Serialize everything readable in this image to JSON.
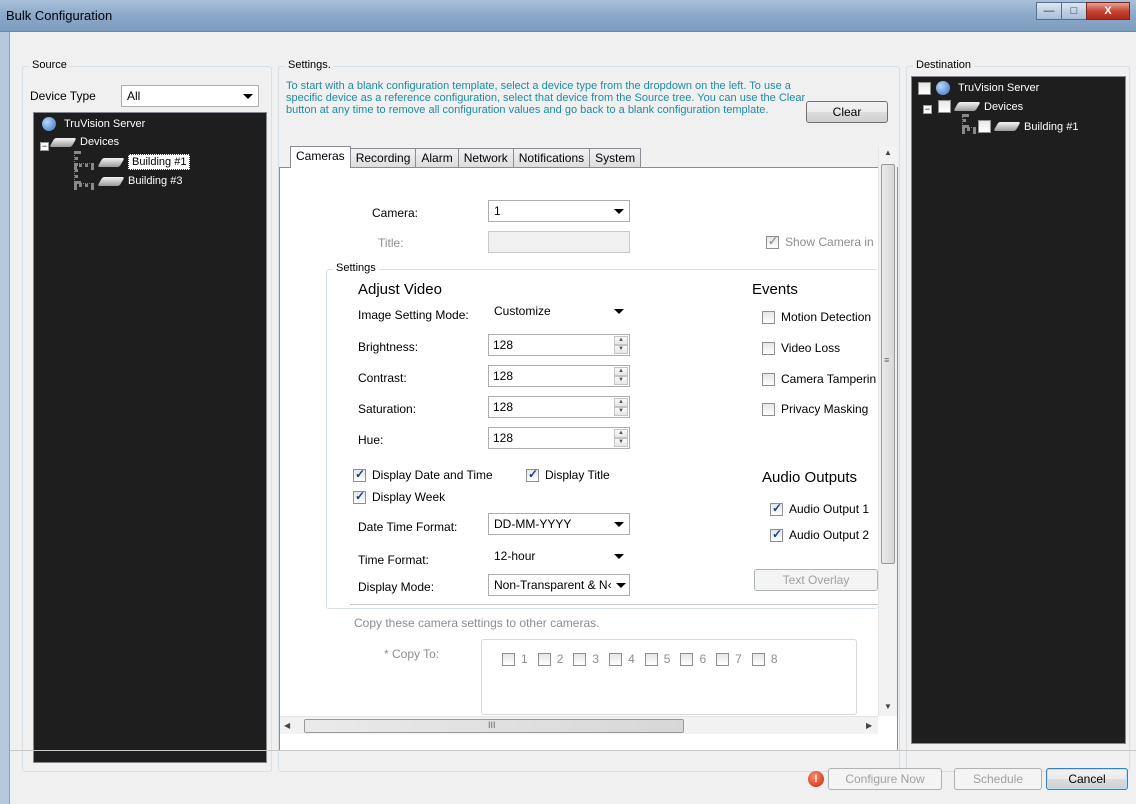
{
  "window": {
    "title": "Bulk Configuration",
    "minimize": "—",
    "maximize": "□",
    "close": "X"
  },
  "source": {
    "legend": "Source",
    "device_type_label": "Device Type",
    "device_type_value": "All",
    "tree": {
      "root": "TruVision Server",
      "devices": "Devices",
      "items": [
        "Building #1",
        "Building #3"
      ]
    }
  },
  "settings": {
    "legend": "Settings.",
    "instructions": "To start with a blank configuration template, select a device type from the dropdown on the left. To use a specific device as a reference configuration, select that device from the Source tree. You can use the Clear button at any time to remove all configuration values and go back to a blank configuration template.",
    "clear_label": "Clear",
    "tabs": [
      "Cameras",
      "Recording",
      "Alarm",
      "Network",
      "Notifications",
      "System"
    ],
    "active_tab": "Cameras",
    "camera_label": "Camera:",
    "camera_value": "1",
    "title_label": "Title:",
    "title_value": "",
    "show_camera_label": "Show Camera in",
    "inner_legend": "Settings",
    "adjust_video": "Adjust Video",
    "image_mode_label": "Image Setting Mode:",
    "image_mode_value": "Customize",
    "brightness_label": "Brightness:",
    "brightness_value": "128",
    "contrast_label": "Contrast:",
    "contrast_value": "128",
    "saturation_label": "Saturation:",
    "saturation_value": "128",
    "hue_label": "Hue:",
    "hue_value": "128",
    "display_date_time": "Display Date and Time",
    "display_title": "Display Title",
    "display_week": "Display Week",
    "date_format_label": "Date Time Format:",
    "date_format_value": "DD-MM-YYYY",
    "time_format_label": "Time Format:",
    "time_format_value": "12-hour",
    "display_mode_label": "Display Mode:",
    "display_mode_value": "Non-Transparent & N‹",
    "events_heading": "Events",
    "motion_detection": "Motion Detection",
    "video_loss": "Video Loss",
    "camera_tampering": "Camera Tamperin",
    "privacy_masking": "Privacy Masking",
    "audio_heading": "Audio Outputs",
    "audio_output_1": "Audio Output 1",
    "audio_output_2": "Audio Output 2",
    "text_overlay": "Text Overlay",
    "copy_hint": "Copy these camera settings to other cameras.",
    "copy_to_label": "* Copy To:",
    "copy_cameras": [
      "1",
      "2",
      "3",
      "4",
      "5",
      "6",
      "7",
      "8"
    ],
    "hscroll_glyph": "III",
    "vscroll_glyph": "≡"
  },
  "destination": {
    "legend": "Destination",
    "tree": {
      "root": "TruVision Server",
      "devices": "Devices",
      "items": [
        "Building #1"
      ]
    }
  },
  "footer": {
    "warning_icon": "!",
    "configure_now": "Configure Now",
    "schedule": "Schedule",
    "cancel": "Cancel"
  },
  "colors": {
    "instruction_text": "#1e8ca0",
    "tree_bg": "#1e1e1e"
  }
}
